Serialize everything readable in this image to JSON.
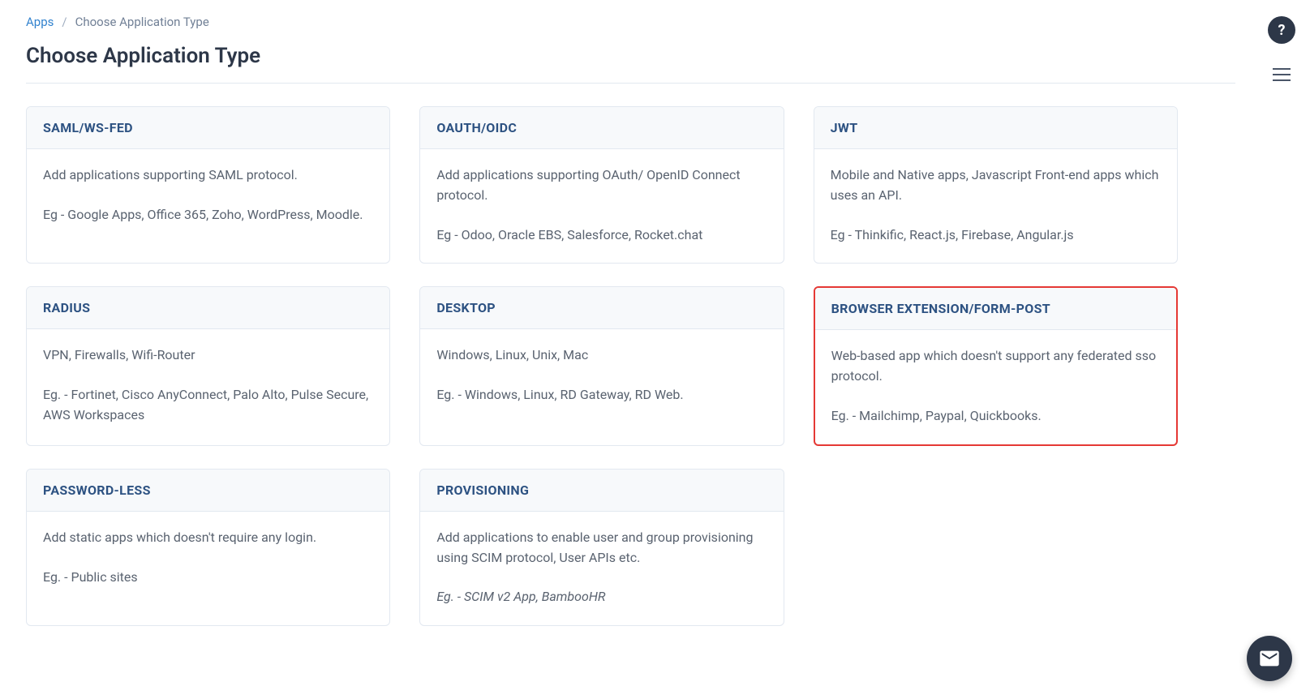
{
  "breadcrumb": {
    "parent": "Apps",
    "current": "Choose Application Type"
  },
  "page_title": "Choose Application Type",
  "cards": [
    {
      "title": "SAML/WS-FED",
      "desc": "Add applications supporting SAML protocol.",
      "example": "Eg - Google Apps, Office 365, Zoho, WordPress, Moodle.",
      "highlighted": false,
      "italicExample": false
    },
    {
      "title": "OAUTH/OIDC",
      "desc": "Add applications supporting OAuth/ OpenID Connect protocol.",
      "example": "Eg - Odoo, Oracle EBS, Salesforce, Rocket.chat",
      "highlighted": false,
      "italicExample": false
    },
    {
      "title": "JWT",
      "desc": "Mobile and Native apps, Javascript Front-end apps which uses an API.",
      "example": "Eg - Thinkific, React.js, Firebase, Angular.js",
      "highlighted": false,
      "italicExample": false
    },
    {
      "title": "RADIUS",
      "desc": "VPN, Firewalls, Wifi-Router",
      "example": "Eg. - Fortinet, Cisco AnyConnect, Palo Alto, Pulse Secure, AWS Workspaces",
      "highlighted": false,
      "italicExample": false
    },
    {
      "title": "DESKTOP",
      "desc": "Windows, Linux, Unix, Mac",
      "example": "Eg. - Windows, Linux, RD Gateway, RD Web.",
      "highlighted": false,
      "italicExample": false
    },
    {
      "title": "BROWSER EXTENSION/FORM-POST",
      "desc": "Web-based app which doesn't support any federated sso protocol.",
      "example": "Eg. - Mailchimp, Paypal, Quickbooks.",
      "highlighted": true,
      "italicExample": false
    },
    {
      "title": "PASSWORD-LESS",
      "desc": "Add static apps which doesn't require any login.",
      "example": "Eg. - Public sites",
      "highlighted": false,
      "italicExample": false
    },
    {
      "title": "PROVISIONING",
      "desc": "Add applications to enable user and group provisioning using SCIM protocol, User APIs etc.",
      "example": "Eg. - SCIM v2 App, BambooHR",
      "highlighted": false,
      "italicExample": true
    }
  ]
}
